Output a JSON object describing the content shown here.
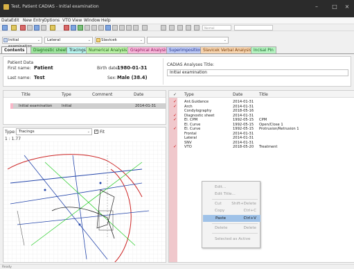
{
  "window": {
    "title": "Test, Patient CADIAS - Initial examination",
    "controls": [
      "–",
      "□",
      "×"
    ]
  },
  "menu": [
    "Data",
    "Edit",
    "New Entry",
    "Options",
    "VTO",
    "View",
    "Window",
    "Help"
  ],
  "toolbar": {
    "zoom_value": "Normal"
  },
  "selectors": {
    "analysis_type": "Initial examination",
    "view": "Lateral",
    "analysis": "Slavicek",
    "extra": ""
  },
  "tabs": [
    {
      "label": "Contents",
      "color": "#ffffff",
      "active": true
    },
    {
      "label": "Diagnostic sheet",
      "color": "#9fe39f"
    },
    {
      "label": "Tracings",
      "color": "#b6f5ef"
    },
    {
      "label": "Numerical Analysis",
      "color": "#b9f0a5"
    },
    {
      "label": "Graphical Analysis",
      "color": "#f7b7d9"
    },
    {
      "label": "Superimposition",
      "color": "#bcc9f5"
    },
    {
      "label": "Slavicek Verbal Analysis",
      "color": "#f7d5b0"
    },
    {
      "label": "Incisal Pin",
      "color": "#b6f3c1"
    }
  ],
  "patient": {
    "section_label": "Patient Data",
    "first_name_label": "First name:",
    "first_name": "Patient",
    "last_name_label": "Last name:",
    "last_name": "Test",
    "birth_label": "Birth date:",
    "birth": "1980-01-31",
    "sex_label": "Sex:",
    "sex": "Male (38.4)",
    "analyses_title_label": "CADIAS Analyses Title:",
    "analyses_title": "Initial examination"
  },
  "examinations": {
    "columns": [
      "Title",
      "Type",
      "Comment",
      "Date"
    ],
    "rows": [
      {
        "title": "Initial examination",
        "type": "Initial",
        "comment": "",
        "date": "2014-01-31"
      }
    ]
  },
  "image_panel": {
    "type_label": "Type:",
    "type_value": "Tracings",
    "fit_label": "Fit",
    "scale": "1 : 1.77"
  },
  "analyses": {
    "columns": [
      "✓",
      "Type",
      "Date",
      "Title"
    ],
    "rows": [
      {
        "checked": true,
        "type": "Ant.Guidance",
        "date": "2014-01-31",
        "title": ""
      },
      {
        "checked": true,
        "type": "Arch",
        "date": "2014-01-31",
        "title": ""
      },
      {
        "checked": false,
        "type": "Condylography",
        "date": "2018-05-16",
        "title": ""
      },
      {
        "checked": true,
        "type": "Diagnostic sheet",
        "date": "2014-01-31",
        "title": ""
      },
      {
        "checked": true,
        "type": "El. CPM",
        "date": "1992-05-15",
        "title": "CPM"
      },
      {
        "checked": false,
        "type": "El. Curve",
        "date": "1992-05-15",
        "title": "Open/Close 1"
      },
      {
        "checked": true,
        "type": "El. Curve",
        "date": "1992-05-15",
        "title": "Protrusion/Retrusion 1"
      },
      {
        "checked": false,
        "type": "Frontal",
        "date": "2014-01-31",
        "title": ""
      },
      {
        "checked": false,
        "type": "Lateral",
        "date": "2014-01-31",
        "title": ""
      },
      {
        "checked": false,
        "type": "SNV",
        "date": "2014-01-31",
        "title": ""
      },
      {
        "checked": true,
        "type": "VTO",
        "date": "2018-05-20",
        "title": "Treatment"
      }
    ]
  },
  "context_menu": {
    "items": [
      {
        "label": "Edit...",
        "shortcut": "",
        "enabled": false
      },
      {
        "label": "Edit Title...",
        "shortcut": "",
        "enabled": false
      },
      {
        "sep": true
      },
      {
        "label": "Cut",
        "shortcut": "Shift+Delete",
        "enabled": false
      },
      {
        "label": "Copy",
        "shortcut": "Ctrl+C",
        "enabled": false
      },
      {
        "label": "Paste",
        "shortcut": "Ctrl+V",
        "enabled": true,
        "highlighted": true
      },
      {
        "sep": true
      },
      {
        "label": "Delete",
        "shortcut": "Delete",
        "enabled": false
      },
      {
        "sep": true
      },
      {
        "label": "Selected as Active",
        "shortcut": "",
        "enabled": false
      }
    ]
  },
  "status": "Ready"
}
